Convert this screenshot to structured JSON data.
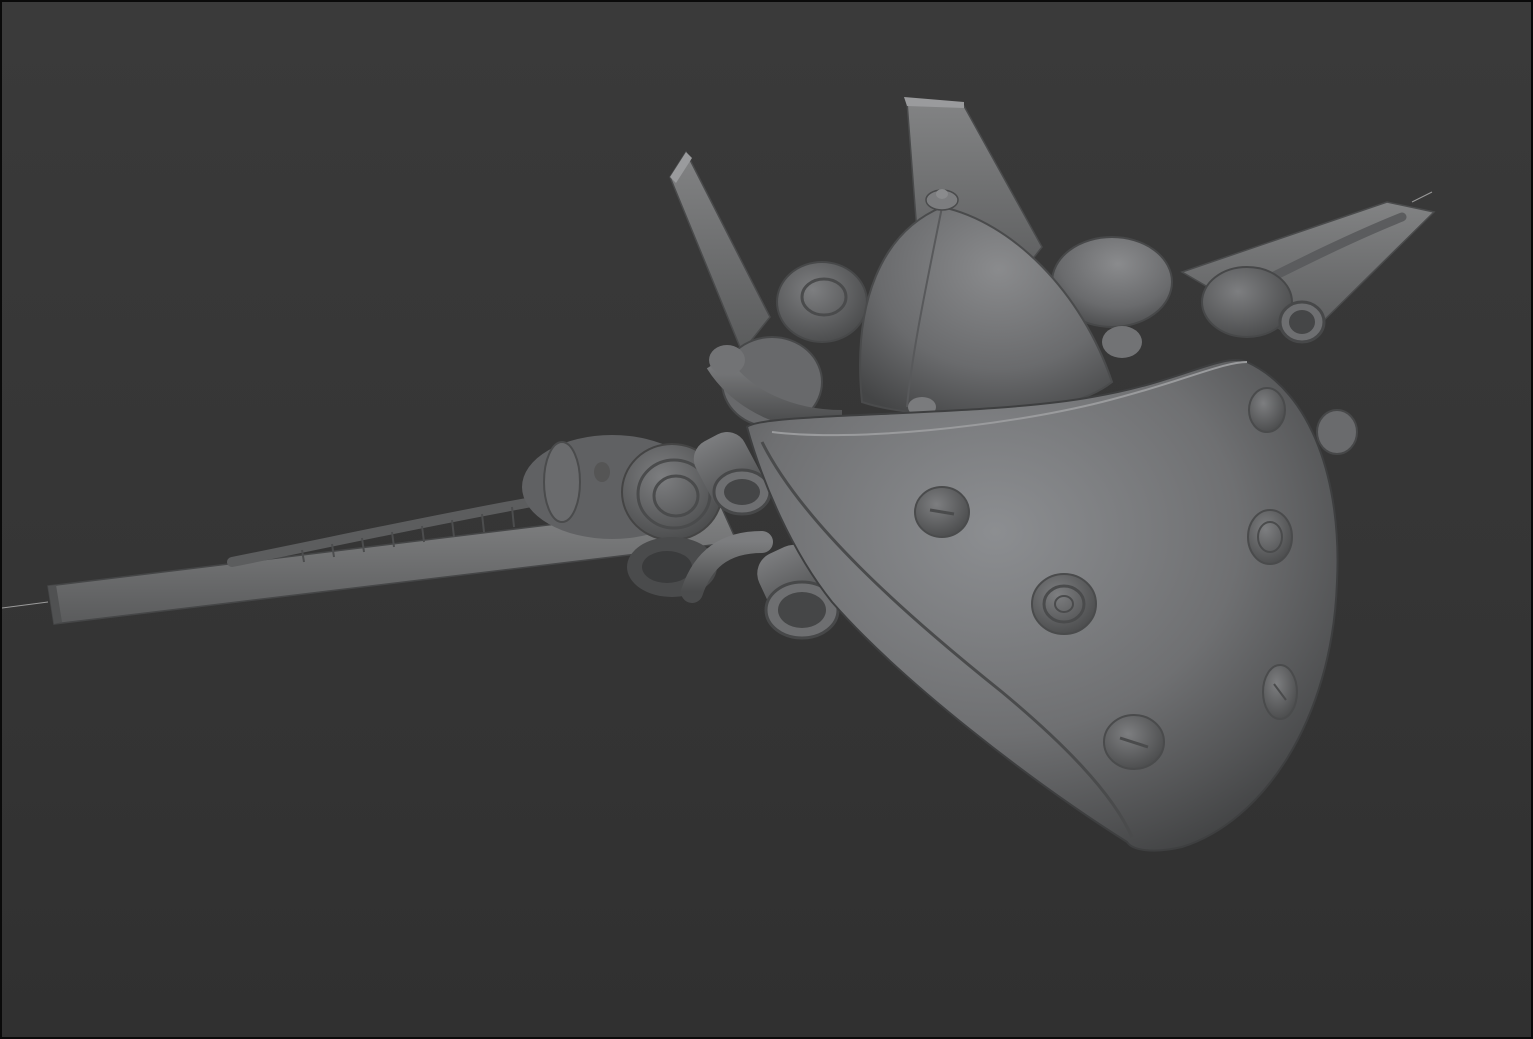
{
  "viewport": {
    "background_color": "#363636",
    "model_color": "#6e6f70",
    "model_highlight": "#8a8c8e",
    "model_shadow": "#3c3c3d"
  },
  "scene": {
    "subject": "spaceship-model-icon"
  }
}
